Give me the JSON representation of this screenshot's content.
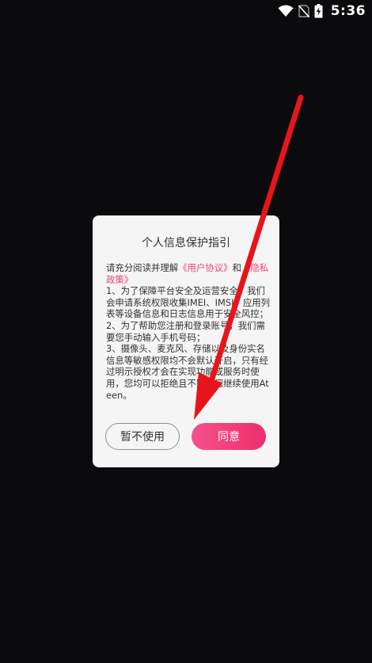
{
  "status_bar": {
    "time": "5:36",
    "icons": [
      "wifi-icon",
      "no-sim-icon",
      "battery-charging-icon"
    ]
  },
  "dialog": {
    "title": "个人信息保护指引",
    "intro_text": "请充分阅读并理解",
    "user_agreement_link": "《用户协议》",
    "and_text": "和",
    "privacy_policy_link": "《隐私政策》",
    "item_1": "1、为了保障平台安全及运营安全，我们会申请系统权限收集IMEI、IMSI、应用列表等设备信息和日志信息用于安全风控；",
    "item_2": "2、为了帮助您注册和登录账号，我们需要您手动输入手机号码；",
    "item_3": "3、摄像头、麦克风、存储以及身份实名信息等敏感权限均不会默认开启，只有经过明示授权才会在实现功能或服务时使用，您均可以拒绝且不影响您继续使用Ateen。",
    "decline_label": "暂不使用",
    "agree_label": "同意"
  },
  "colors": {
    "background": "#0b0b0d",
    "dialog_bg": "#f5f5f5",
    "link": "#ee3f7d",
    "agree_button": "#f24a85",
    "annotation_arrow": "#e8141c"
  }
}
